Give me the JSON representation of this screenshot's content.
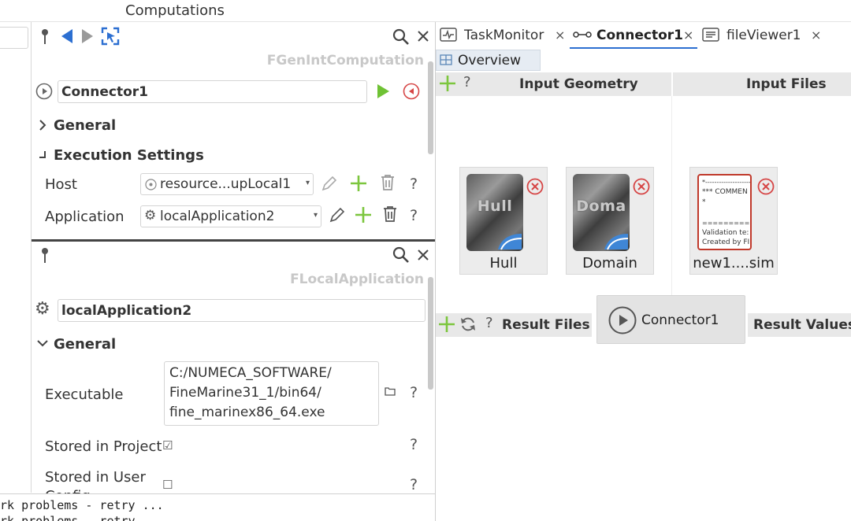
{
  "menu": {
    "computations": "Computations"
  },
  "upper_panel": {
    "class_name": "FGenIntComputation",
    "name_value": "Connector1",
    "general_label": "General",
    "exec_settings_label": "Execution Settings",
    "host_label": "Host",
    "host_value": "resource...upLocal1",
    "application_label": "Application",
    "application_value": "localApplication2",
    "help": "?"
  },
  "lower_panel": {
    "class_name": "FLocalApplication",
    "name_value": "localApplication2",
    "general_label": "General",
    "executable_label": "Executable",
    "executable_lines": [
      "C:/NUMECA_SOFTWARE/",
      "FineMarine31_1/bin64/",
      "fine_marinex86_64.exe"
    ],
    "stored_project_label": "Stored in Project",
    "stored_project_check": "☑",
    "stored_user_label": "Stored in User",
    "stored_user_label2": "Config",
    "stored_user_check": "☐",
    "help": "?"
  },
  "console": {
    "lines": [
      "rk problems - retry ...",
      "rk problems - retry ..."
    ]
  },
  "tabs": [
    {
      "label": "TaskMonitor",
      "close": "×"
    },
    {
      "label": "Connector1",
      "close": "×"
    },
    {
      "label": "fileViewer1",
      "close": "×"
    }
  ],
  "overview_tab": "Overview",
  "editor": {
    "add": "+",
    "help": "?",
    "input_geometry": "Input Geometry",
    "input_files": "Input Files",
    "result_files": "Result Files",
    "result_values": "Result Values",
    "hull_thumb": "Hull",
    "hull_label": "Hull",
    "domain_thumb": "Doma",
    "domain_label": "Domain",
    "file_label": "new1....sim",
    "file_preview": [
      "*---------------------",
      "*** COMMEN",
      "*",
      "=====================",
      "Validation te:",
      "Created by FI"
    ],
    "connector_node": "Connector1"
  }
}
